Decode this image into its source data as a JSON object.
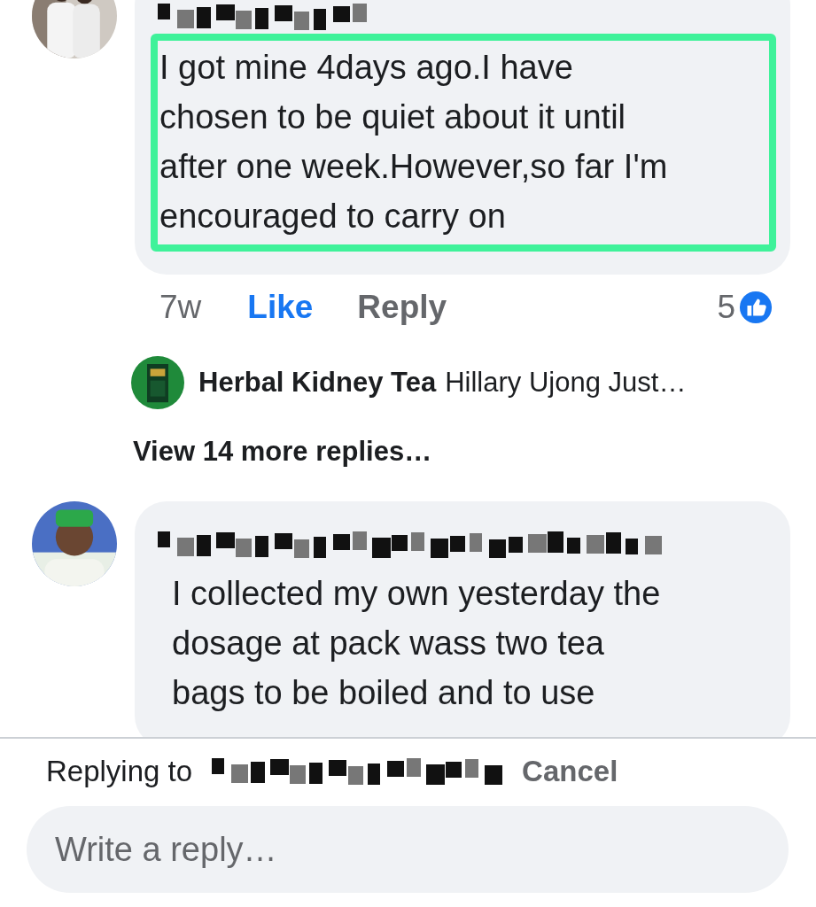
{
  "thread": [
    {
      "kind": "comment",
      "body": "I got mine 4days ago.I have\nchosen to be quiet about it until\nafter one week.However,so far I'm\nencouraged to carry on",
      "highlighted": true,
      "actions": {
        "time": "7w",
        "like": "Like",
        "liked": true,
        "reply": "Reply",
        "reaction_count": "5"
      }
    },
    {
      "kind": "reply_preview",
      "author": "Herbal Kidney Tea",
      "snippet": "Hillary Ujong Just…"
    },
    {
      "kind": "more_replies",
      "label": "View 14 more replies…"
    },
    {
      "kind": "comment",
      "body": "I collected my own yesterday the\ndosage at pack wass two tea\nbags to be boiled and to use",
      "highlighted": false
    }
  ],
  "composer": {
    "replying_label": "Replying to",
    "cancel": "Cancel",
    "placeholder": "Write a reply…"
  }
}
